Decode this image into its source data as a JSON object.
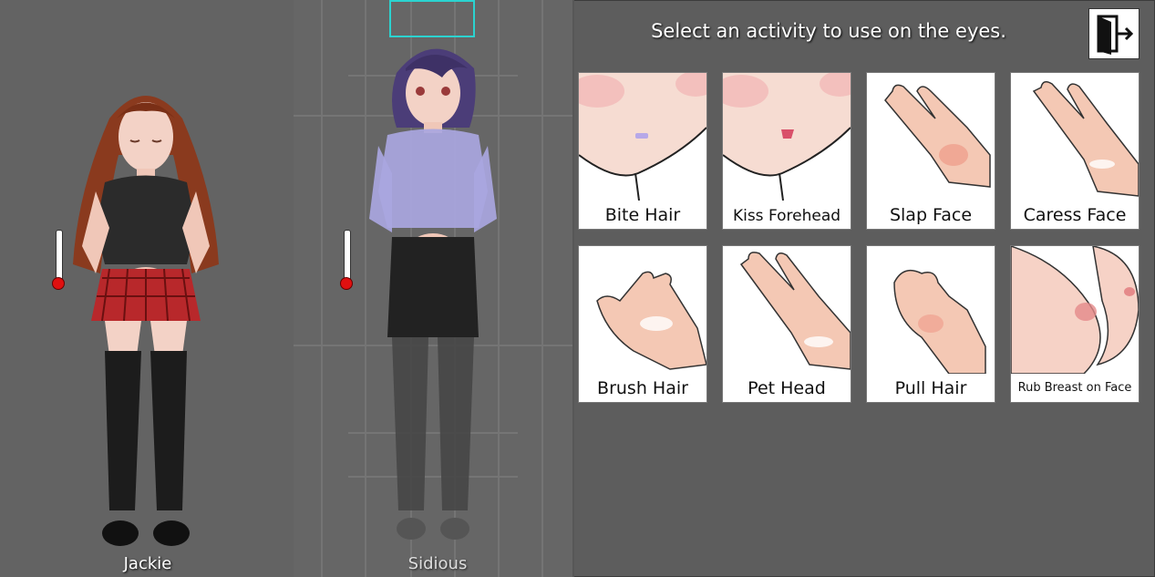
{
  "prompt": "Select an activity to use on the eyes.",
  "exit_button": {
    "icon": "exit-door-icon"
  },
  "characters": [
    {
      "name": "Jackie",
      "hair_color": "#8a3a1e",
      "top_color": "#2b2b2b",
      "skirt_color": "#b8282b"
    },
    {
      "name": "Sidious",
      "hair_color": "#4b3d78",
      "top_color": "#a9a6e0",
      "skirt_color": "#222222"
    }
  ],
  "activities": [
    {
      "label": "Bite Hair",
      "icon": "face-closeup-icon"
    },
    {
      "label": "Kiss Forehead",
      "icon": "face-closeup-icon"
    },
    {
      "label": "Slap Face",
      "icon": "hand-icon"
    },
    {
      "label": "Caress Face",
      "icon": "hand-icon"
    },
    {
      "label": "Brush Hair",
      "icon": "hand-icon"
    },
    {
      "label": "Pet Head",
      "icon": "hand-icon"
    },
    {
      "label": "Pull Hair",
      "icon": "pinch-hand-icon"
    },
    {
      "label": "Rub Breast on Face",
      "icon": "breast-icon"
    }
  ]
}
